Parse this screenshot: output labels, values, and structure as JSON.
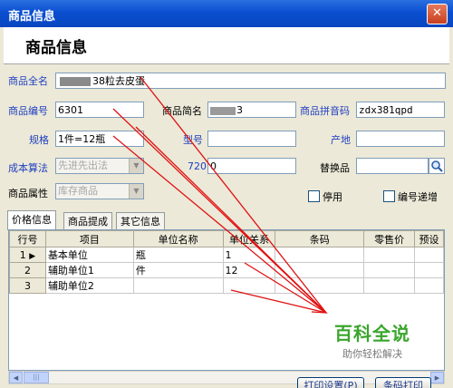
{
  "window": {
    "title": "商品信息",
    "close_glyph": "✕"
  },
  "header": {
    "title": "商品信息"
  },
  "form": {
    "full_name_label": "商品全名",
    "full_name_value": "38粒去皮蛋",
    "code_label": "商品编号",
    "code_value": "6301",
    "short_name_label": "商品简名",
    "short_name_value": "3",
    "pinyin_label": "商品拼音码",
    "pinyin_value": "zdx381qpd",
    "spec_label": "规格",
    "spec_value": "1件=12瓶",
    "model_label": "型号",
    "model_value": "",
    "origin_label": "产地",
    "origin_value": "",
    "cost_label": "成本算法",
    "cost_value": "先进先出法",
    "num720_label": "720",
    "num720_value": "0",
    "replace_label": "替换品",
    "replace_value": "",
    "attr_label": "商品属性",
    "attr_value": "库存商品",
    "disable_label": "停用",
    "autoinc_label": "编号递增",
    "arrow_glyph": "▼",
    "search_icon": "magnifier-icon"
  },
  "tabs": [
    {
      "label": "价格信息"
    },
    {
      "label": "商品提成"
    },
    {
      "label": "其它信息"
    }
  ],
  "grid": {
    "columns": [
      "行号",
      "项目",
      "单位名称",
      "单位关系",
      "条码",
      "零售价",
      "预设"
    ],
    "rows": [
      {
        "num": "1",
        "item": "基本单位",
        "unit": "瓶",
        "rel": "1",
        "barcode": "",
        "retail": "",
        "preset": "",
        "pointer": "▶"
      },
      {
        "num": "2",
        "item": "辅助单位1",
        "unit": "件",
        "rel": "12",
        "barcode": "",
        "retail": "",
        "preset": ""
      },
      {
        "num": "3",
        "item": "辅助单位2",
        "unit": "",
        "rel": "",
        "barcode": "",
        "retail": "",
        "preset": ""
      }
    ]
  },
  "scroll": {
    "left": "◀",
    "right": "▶",
    "grip": "|||"
  },
  "buttons": {
    "print_setup": "打印设置(P)",
    "barcode_print": "条码打印"
  },
  "watermark": {
    "title": "百科全说",
    "subtitle": "助你轻松解决"
  },
  "colors": {
    "label_blue": "#1f3fbf",
    "annotation_red": "#e01010",
    "title_bar": "#0a4fd0"
  }
}
